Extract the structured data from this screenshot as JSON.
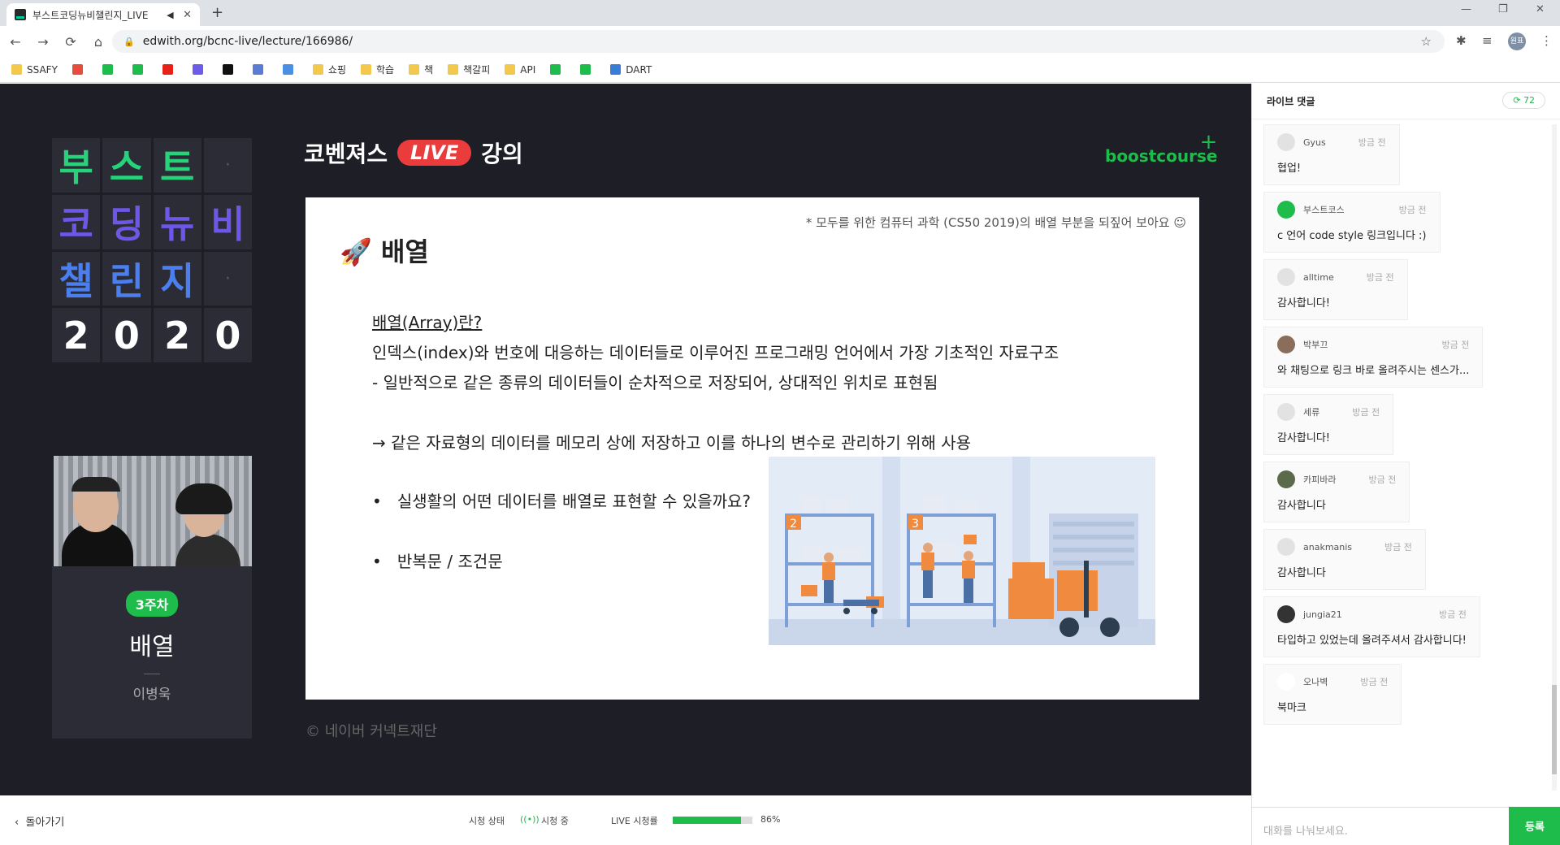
{
  "tab": {
    "title": "부스트코딩뉴비챌린지_LIVE",
    "speaker": "◀",
    "close": "✕",
    "new": "+"
  },
  "window": {
    "min": "—",
    "restore": "❐",
    "close": "✕"
  },
  "nav": {
    "back": "←",
    "forward": "→",
    "reload": "⟳",
    "home": "⌂",
    "url": "edwith.org/bcnc-live/lecture/166986/",
    "profile": "원표"
  },
  "bookmarks": [
    {
      "label": "SSAFY",
      "color": "#f2c94c"
    },
    {
      "label": "",
      "color": "#e74c3c"
    },
    {
      "label": "",
      "color": "#1ebc4b"
    },
    {
      "label": "",
      "color": "#1ebc4b"
    },
    {
      "label": "",
      "color": "#e62117"
    },
    {
      "label": "",
      "color": "#6c5ce7"
    },
    {
      "label": "",
      "color": "#111111"
    },
    {
      "label": "",
      "color": "#5b7bd5"
    },
    {
      "label": "",
      "color": "#4a90e2"
    },
    {
      "label": "쇼핑",
      "color": "#f2c94c"
    },
    {
      "label": "학습",
      "color": "#f2c94c"
    },
    {
      "label": "책",
      "color": "#f2c94c"
    },
    {
      "label": "책갈피",
      "color": "#f2c94c"
    },
    {
      "label": "API",
      "color": "#f2c94c"
    },
    {
      "label": "",
      "color": "#1ebc4b"
    },
    {
      "label": "",
      "color": "#1ebc4b"
    },
    {
      "label": "DART",
      "color": "#3a7bd5"
    }
  ],
  "logo": {
    "cells": [
      "부",
      "스",
      "트",
      "·",
      "코",
      "딩",
      "뉴",
      "비",
      "챌",
      "린",
      "지",
      "·",
      "2",
      "0",
      "2",
      "0"
    ],
    "colors": [
      "#27d37a",
      "#27d37a",
      "#27d37a",
      "#555",
      "#6e56e8",
      "#6e56e8",
      "#6e56e8",
      "#6e56e8",
      "#4b7ff0",
      "#4b7ff0",
      "#4b7ff0",
      "#555",
      "#ffffff",
      "#ffffff",
      "#ffffff",
      "#ffffff"
    ]
  },
  "lecture": {
    "week": "3주차",
    "title": "배열",
    "teacher": "이병욱"
  },
  "header": {
    "prefix": "코벤져스",
    "live": "LIVE",
    "suffix": "강의",
    "brand": "boostcourse"
  },
  "slide": {
    "note": "* 모두를 위한 컴퓨터 과학 (CS50 2019)의 배열 부분을 되짚어 보아요 ☺",
    "title": "배열",
    "lines": [
      "배열(Array)란?",
      "인덱스(index)와 번호에 대응하는 데이터들로 이루어진 프로그래밍 언어에서 가장 기초적인 자료구조",
      "- 일반적으로 같은 종류의 데이터들이 순차적으로 저장되어, 상대적인 위치로 표현됨",
      "",
      "→ 같은 자료형의 데이터를 메모리 상에 저장하고 이를 하나의 변수로 관리하기 위해 사용"
    ],
    "bullets": [
      "실생활의 어떤 데이터를 배열로 표현할 수 있을까요?",
      "반복문 / 조건문"
    ],
    "shelf_labels": [
      "2",
      "3"
    ]
  },
  "footer": "© 네이버 커넥트재단",
  "bottom": {
    "back": "돌아가기",
    "status_label": "시청 상태",
    "status_value": "시청 중",
    "rate_label": "LIVE 시청률",
    "rate": "86%",
    "rate_value": 0.86
  },
  "chat": {
    "title": "라이브 댓글",
    "count": "72",
    "placeholder": "대화를 나눠보세요.",
    "send": "등록",
    "messages": [
      {
        "user": "Gyus",
        "time": "방금 전",
        "text": "협업!"
      },
      {
        "user": "부스트코스",
        "time": "방금 전",
        "text": "c 언어 code style 링크입니다 :)"
      },
      {
        "user": "alltime",
        "time": "방금 전",
        "text": "감사합니다!"
      },
      {
        "user": "박부끄",
        "time": "방금 전",
        "text": "와 채팅으로 링크 바로 올려주시는 센스가..."
      },
      {
        "user": "세류",
        "time": "방금 전",
        "text": "감사합니다!"
      },
      {
        "user": "카피바라",
        "time": "방금 전",
        "text": "감사합니다"
      },
      {
        "user": "anakmanis",
        "time": "방금 전",
        "text": "감사합니다"
      },
      {
        "user": "jungia21",
        "time": "방금 전",
        "text": "타입하고 있었는데 올려주셔서 감사합니다!"
      },
      {
        "user": "오나벽",
        "time": "방금 전",
        "text": "북마크"
      }
    ]
  }
}
